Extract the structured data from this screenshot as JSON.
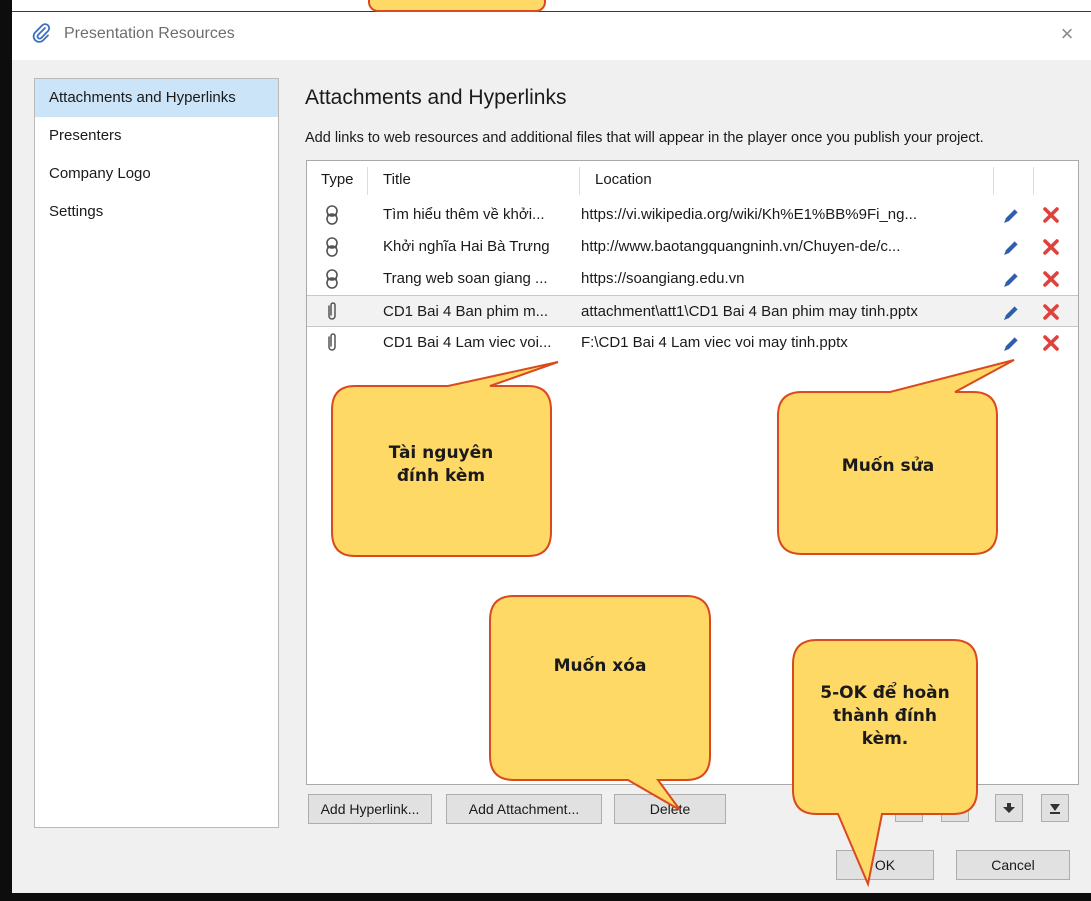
{
  "window": {
    "title": "Presentation Resources",
    "close_glyph": "×"
  },
  "sidebar": {
    "items": [
      {
        "label": "Attachments and Hyperlinks",
        "selected": true
      },
      {
        "label": "Presenters",
        "selected": false
      },
      {
        "label": "Company Logo",
        "selected": false
      },
      {
        "label": "Settings",
        "selected": false
      }
    ]
  },
  "main": {
    "title": "Attachments and Hyperlinks",
    "description": "Add links to web resources and additional files that will appear in the player once you publish your project.",
    "columns": {
      "type": "Type",
      "title": "Title",
      "location": "Location"
    },
    "rows": [
      {
        "type_icon": "hyperlink-icon",
        "title": "Tìm hiểu thêm về khởi...",
        "location": "https://vi.wikipedia.org/wiki/Kh%E1%BB%9Fi_ng...",
        "selected": false
      },
      {
        "type_icon": "hyperlink-icon",
        "title": "Khởi nghĩa Hai Bà Trưng",
        "location": "http://www.baotangquangninh.vn/Chuyen-de/c...",
        "selected": false
      },
      {
        "type_icon": "hyperlink-icon",
        "title": "Trang web soan giang ...",
        "location": "https://soangiang.edu.vn",
        "selected": false
      },
      {
        "type_icon": "attachment-icon",
        "title": "CD1 Bai 4 Ban phim m...",
        "location": "attachment\\att1\\CD1 Bai 4 Ban phim may tinh.pptx",
        "selected": true
      },
      {
        "type_icon": "attachment-icon",
        "title": "CD1 Bai 4 Lam viec voi...",
        "location": "F:\\CD1 Bai 4 Lam viec voi may tinh.pptx",
        "selected": false
      }
    ],
    "row_action_icons": {
      "edit": "pencil-icon",
      "delete": "red-x-icon"
    }
  },
  "buttons": {
    "add_hyperlink": "Add Hyperlink...",
    "add_attachment": "Add Attachment...",
    "delete": "Delete",
    "ok": "OK",
    "cancel": "Cancel"
  },
  "reorder_icons": [
    "move-to-top-icon",
    "move-up-icon",
    "move-down-icon",
    "move-to-bottom-icon"
  ],
  "callouts": {
    "resources": "Tài nguyên\nđính kèm",
    "edit": "Muốn sửa",
    "delete": "Muốn xóa",
    "ok": "5-OK để hoàn\nthành đính\nkèm."
  },
  "colors": {
    "selection": "#cce4f7",
    "callout_fill": "#ffd966",
    "callout_border": "#d94a1e",
    "delete_red": "#e0413c",
    "pencil_blue": "#2e5fa8"
  }
}
